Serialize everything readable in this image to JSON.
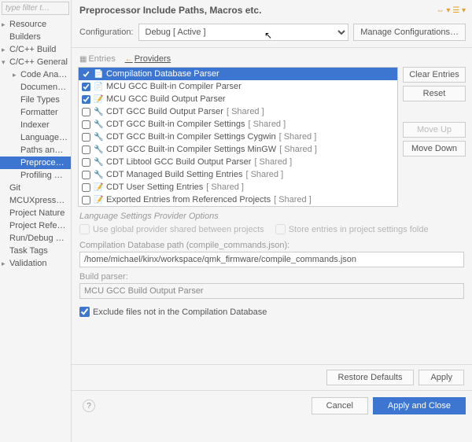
{
  "sidebar": {
    "filter_placeholder": "type filter t…",
    "items": [
      {
        "label": "Resource",
        "level": 0,
        "expand": "▸"
      },
      {
        "label": "Builders",
        "level": 0,
        "expand": ""
      },
      {
        "label": "C/C++ Build",
        "level": 0,
        "expand": "▸"
      },
      {
        "label": "C/C++ General",
        "level": 0,
        "expand": "▾"
      },
      {
        "label": "Code Analysis",
        "level": 1,
        "expand": "▸"
      },
      {
        "label": "Documentatio",
        "level": 1,
        "expand": ""
      },
      {
        "label": "File Types",
        "level": 1,
        "expand": ""
      },
      {
        "label": "Formatter",
        "level": 1,
        "expand": ""
      },
      {
        "label": "Indexer",
        "level": 1,
        "expand": ""
      },
      {
        "label": "Language Ma",
        "level": 1,
        "expand": ""
      },
      {
        "label": "Paths and Sym",
        "level": 1,
        "expand": ""
      },
      {
        "label": "Preprocessor",
        "level": 1,
        "expand": "",
        "selected": true
      },
      {
        "label": "Profiling Cate",
        "level": 1,
        "expand": ""
      },
      {
        "label": "Git",
        "level": 0,
        "expand": ""
      },
      {
        "label": "MCUXpresso C",
        "level": 0,
        "expand": ""
      },
      {
        "label": "Project Nature",
        "level": 0,
        "expand": ""
      },
      {
        "label": "Project Referen",
        "level": 0,
        "expand": ""
      },
      {
        "label": "Run/Debug Set",
        "level": 0,
        "expand": ""
      },
      {
        "label": "Task Tags",
        "level": 0,
        "expand": ""
      },
      {
        "label": "Validation",
        "level": 0,
        "expand": "▸"
      }
    ]
  },
  "header": {
    "title": "Preprocessor Include Paths, Macros etc."
  },
  "config": {
    "label": "Configuration:",
    "value": "Debug  [ Active ]",
    "manage": "Manage Configurations…"
  },
  "tabs": {
    "entries": "Entries",
    "providers": "Providers"
  },
  "providers": [
    {
      "checked": true,
      "icon": "📄",
      "label": "Compilation Database Parser",
      "shared": "",
      "selected": true
    },
    {
      "checked": true,
      "icon": "📄",
      "label": "MCU GCC Built-in Compiler Parser",
      "shared": ""
    },
    {
      "checked": true,
      "icon": "📝",
      "label": "MCU GCC Build Output Parser",
      "shared": ""
    },
    {
      "checked": false,
      "icon": "🔧",
      "label": "CDT GCC Build Output Parser",
      "shared": "[ Shared ]"
    },
    {
      "checked": false,
      "icon": "🔧",
      "label": "CDT GCC Built-in Compiler Settings",
      "shared": "[ Shared ]"
    },
    {
      "checked": false,
      "icon": "🔧",
      "label": "CDT GCC Built-in Compiler Settings Cygwin",
      "shared": "[ Shared ]"
    },
    {
      "checked": false,
      "icon": "🔧",
      "label": "CDT GCC Built-in Compiler Settings MinGW",
      "shared": "[ Shared ]"
    },
    {
      "checked": false,
      "icon": "🔧",
      "label": "CDT Libtool GCC Build Output Parser",
      "shared": "[ Shared ]"
    },
    {
      "checked": false,
      "icon": "🔧",
      "label": "CDT Managed Build Setting Entries",
      "shared": "[ Shared ]"
    },
    {
      "checked": false,
      "icon": "📝",
      "label": "CDT User Setting Entries",
      "shared": "[ Shared ]"
    },
    {
      "checked": false,
      "icon": "📝",
      "label": "Exported Entries from Referenced Projects",
      "shared": "[ Shared ]"
    }
  ],
  "sidebtns": {
    "clear": "Clear Entries",
    "reset": "Reset",
    "moveup": "Move Up",
    "movedown": "Move Down"
  },
  "options": {
    "title": "Language Settings Provider Options",
    "use_global": "Use global provider shared between projects",
    "store_entries": "Store entries in project settings folde",
    "db_path_label": "Compilation Database path (compile_commands.json):",
    "db_path_value": "/home/michael/kinx/workspace/qmk_firmware/compile_commands.json",
    "build_parser_label": "Build parser:",
    "build_parser_value": "MCU GCC Build Output Parser",
    "exclude": "Exclude files not in the Compilation Database"
  },
  "buttons": {
    "restore": "Restore Defaults",
    "apply": "Apply",
    "cancel": "Cancel",
    "apply_close": "Apply and Close"
  }
}
